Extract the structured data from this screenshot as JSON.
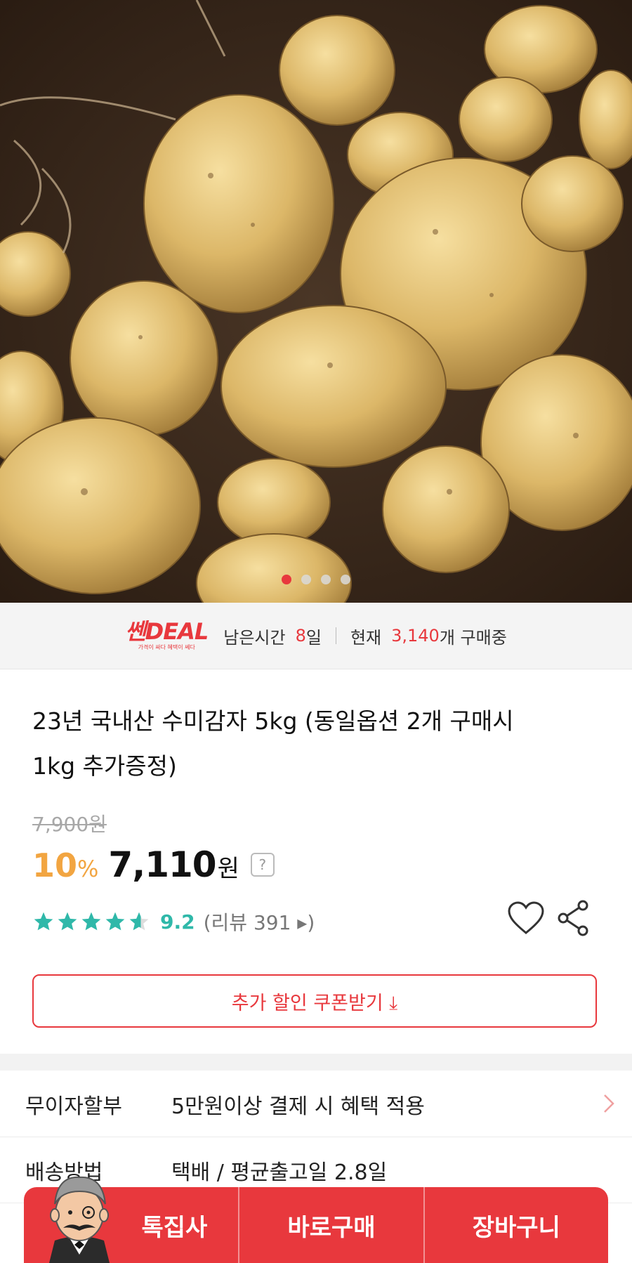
{
  "carousel": {
    "total": 4,
    "active": 0
  },
  "deal_bar": {
    "logo_text": "쎈DEAL",
    "logo_sub": "가격이 싸다 혜택이 쎄다",
    "remaining_label": "남은시간",
    "remaining_value": "8",
    "remaining_unit": "일",
    "current_label": "현재",
    "current_value": "3,140",
    "current_unit": "개 구매중"
  },
  "product": {
    "title_line1": "23년 국내산 수미감자 5kg (동일옵션 2개 구매시",
    "title_line2": "1kg 추가증정)",
    "original_price": "7,900원",
    "discount_pct": "10",
    "discount_sign": "%",
    "price": "7,110",
    "currency": "원",
    "help": "?",
    "rating": {
      "stars": 4.6,
      "score": "9.2",
      "review_label": "(리뷰 391 ▸)"
    }
  },
  "coupon": {
    "label": "추가 할인 쿠폰받기 ⤓"
  },
  "info": [
    {
      "label": "무이자할부",
      "value": "5만원이상 결제 시 혜택 적용"
    },
    {
      "label": "배송방법",
      "value": "택배 / 평균출고일 2.8일"
    }
  ],
  "bottom_bar": {
    "special": "톡집사",
    "buy_now": "바로구매",
    "cart": "장바구니"
  },
  "colors": {
    "accent": "#e8383d",
    "teal": "#2fb8a9",
    "orange": "#f2a541"
  }
}
